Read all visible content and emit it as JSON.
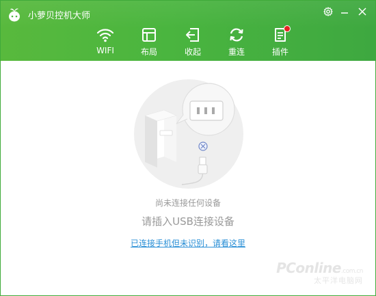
{
  "app": {
    "title": "小萝贝控机大师"
  },
  "window_controls": {
    "settings_icon": "gear-icon",
    "minimize_icon": "minimize-icon",
    "close_icon": "close-icon"
  },
  "toolbar": {
    "items": [
      {
        "label": "WIFI",
        "icon": "wifi-icon"
      },
      {
        "label": "布局",
        "icon": "layout-icon"
      },
      {
        "label": "收起",
        "icon": "collapse-icon"
      },
      {
        "label": "重连",
        "icon": "reconnect-icon"
      },
      {
        "label": "插件",
        "icon": "plugin-icon",
        "has_badge": true
      }
    ]
  },
  "status": {
    "no_device": "尚未连接任何设备",
    "instruction": "请插入USB连接设备",
    "help_link": "已连接手机但未识别，请看这里"
  },
  "watermark": {
    "brand": "PConline",
    "domain": ".com.cn",
    "subtitle": "太平洋电脑网"
  },
  "colors": {
    "header_green": "#4ab53f",
    "link_blue": "#2a8fd6",
    "badge_red": "#e52222",
    "text_gray": "#999999"
  }
}
